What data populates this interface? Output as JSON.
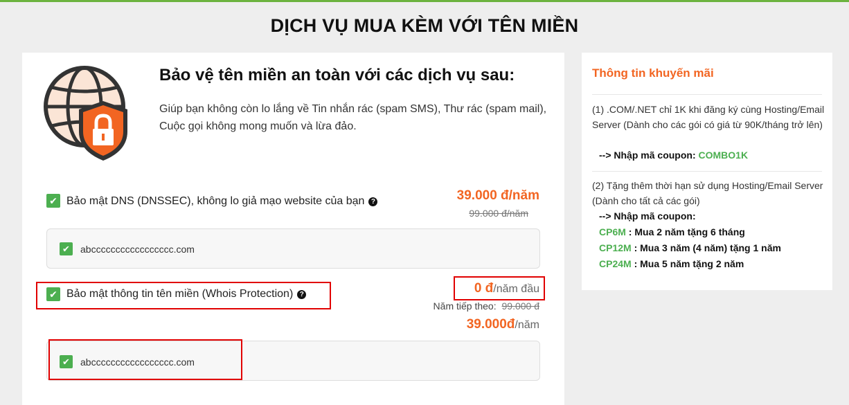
{
  "page": {
    "title": "DỊCH VỤ MUA KÈM VỚI TÊN MIỀN"
  },
  "intro": {
    "title": "Bảo vệ tên miền an toàn với các dịch vụ sau:",
    "description": "Giúp bạn không còn lo lắng về Tin nhắn rác (spam SMS), Thư rác (spam mail), Cuộc gọi không mong muốn và lừa đảo."
  },
  "services": [
    {
      "label": "Bảo mật DNS (DNSSEC), không lo giả mạo website của bạn",
      "checked": true,
      "price": "39.000 đ/năm",
      "old_price": "99.000 đ/năm",
      "domain": "abccccccccccccccccc.com",
      "domain_checked": true
    },
    {
      "label": "Bảo mật thông tin tên miền (Whois Protection)",
      "checked": true,
      "price_value": "0 đ",
      "price_suffix": "/năm đầu",
      "next_label": "Năm tiếp theo:",
      "next_old_price": "99.000 đ",
      "renew_value": "39.000đ",
      "renew_suffix": "/năm",
      "domain": "abccccccccccccccccc.com",
      "domain_checked": true
    }
  ],
  "promo": {
    "title": "Thông tin khuyến mãi",
    "item1_text": "(1) .COM/.NET chỉ 1K khi đăng ký cùng Hosting/Email Server (Dành cho các gói có giá từ 90K/tháng trở lên)",
    "item1_prefix": "--> Nhập mã coupon:",
    "item1_code": "COMBO1K",
    "item2_text": "(2) Tặng thêm thời hạn sử dụng Hosting/Email Server (Dành cho tất cả các gói)",
    "item2_prefix": "--> Nhập mã coupon:",
    "coupons": [
      {
        "code": "CP6M",
        "desc": ": Mua 2 năm tặng 6 tháng"
      },
      {
        "code": "CP12M",
        "desc": ": Mua 3 năm (4 năm) tặng 1 năm"
      },
      {
        "code": "CP24M",
        "desc": ": Mua 5 năm tặng 2 năm"
      }
    ]
  },
  "colors": {
    "accent": "#f26522",
    "green": "#4caf50",
    "highlight": "#e10000"
  },
  "icons": [
    "globe-shield-lock-icon",
    "check-icon",
    "question-circle-icon"
  ]
}
